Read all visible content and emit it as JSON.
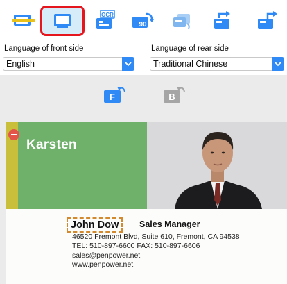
{
  "toolbar": {
    "buttons": [
      {
        "icon": "scan-icon",
        "selected": false
      },
      {
        "icon": "single-side-icon",
        "selected": true
      },
      {
        "icon": "ocr-icon",
        "selected": false,
        "text": "OCR"
      },
      {
        "icon": "rotate-90-icon",
        "selected": false,
        "text": "90"
      },
      {
        "icon": "flip-card-icon",
        "selected": false
      },
      {
        "icon": "export-icon",
        "selected": false
      },
      {
        "icon": "export-alt-icon",
        "selected": false
      }
    ]
  },
  "language": {
    "front_label": "Language of front side",
    "front_value": "English",
    "rear_label": "Language of rear side",
    "rear_value": "Traditional Chinese"
  },
  "side_buttons": {
    "front": "F",
    "back": "B"
  },
  "card": {
    "company": "Karsten",
    "name": "John Dow",
    "title": "Sales Manager",
    "address": "46520 Fremont Blvd, Suite 610, Fremont, CA 94538",
    "phone_fax": "TEL: 510-897-6600     FAX: 510-897-6606",
    "email": "sales@penpower.net",
    "website": "www.penpower.net"
  },
  "colors": {
    "accent": "#2f8af5",
    "selection_border": "#e5161d",
    "card_green": "#6fb06b",
    "name_box": "#d38a2e"
  }
}
